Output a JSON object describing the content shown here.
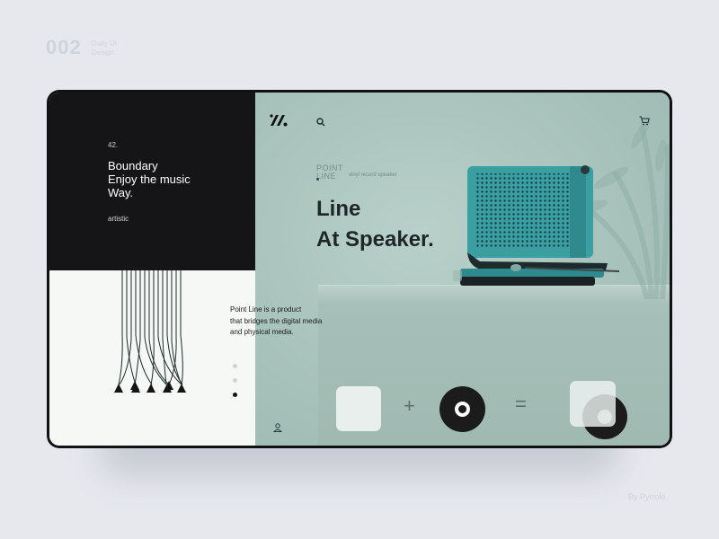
{
  "corner": {
    "number": "002",
    "note_line1": "Daily UI",
    "note_line2": "Design."
  },
  "byline": "By Pyrrole.",
  "left_panel": {
    "issue": "42.",
    "headline": [
      "Boundary",
      "Enjoy the music",
      "Way."
    ],
    "tag": "artistic"
  },
  "product": {
    "brand_line1": "POINT",
    "brand_line2": "LINE",
    "brand_sub": "vinyl record speaker",
    "title": [
      "Line",
      "At Speaker."
    ],
    "description": [
      "Point Line is a product",
      "that bridges the digital media",
      "and physical media."
    ]
  },
  "nav": {
    "active_dot": 3,
    "dot_count": 3
  },
  "icons": {
    "logo": "logo-icon",
    "search": "search-icon",
    "cart": "cart-icon",
    "user": "user-icon"
  },
  "equation": {
    "plus": "+",
    "equals": "="
  },
  "colors": {
    "panel_dark": "#151517",
    "mint_bg": "#a8c3bb",
    "speaker_teal": "#3a9a9c",
    "text_dark": "#1f2628"
  }
}
